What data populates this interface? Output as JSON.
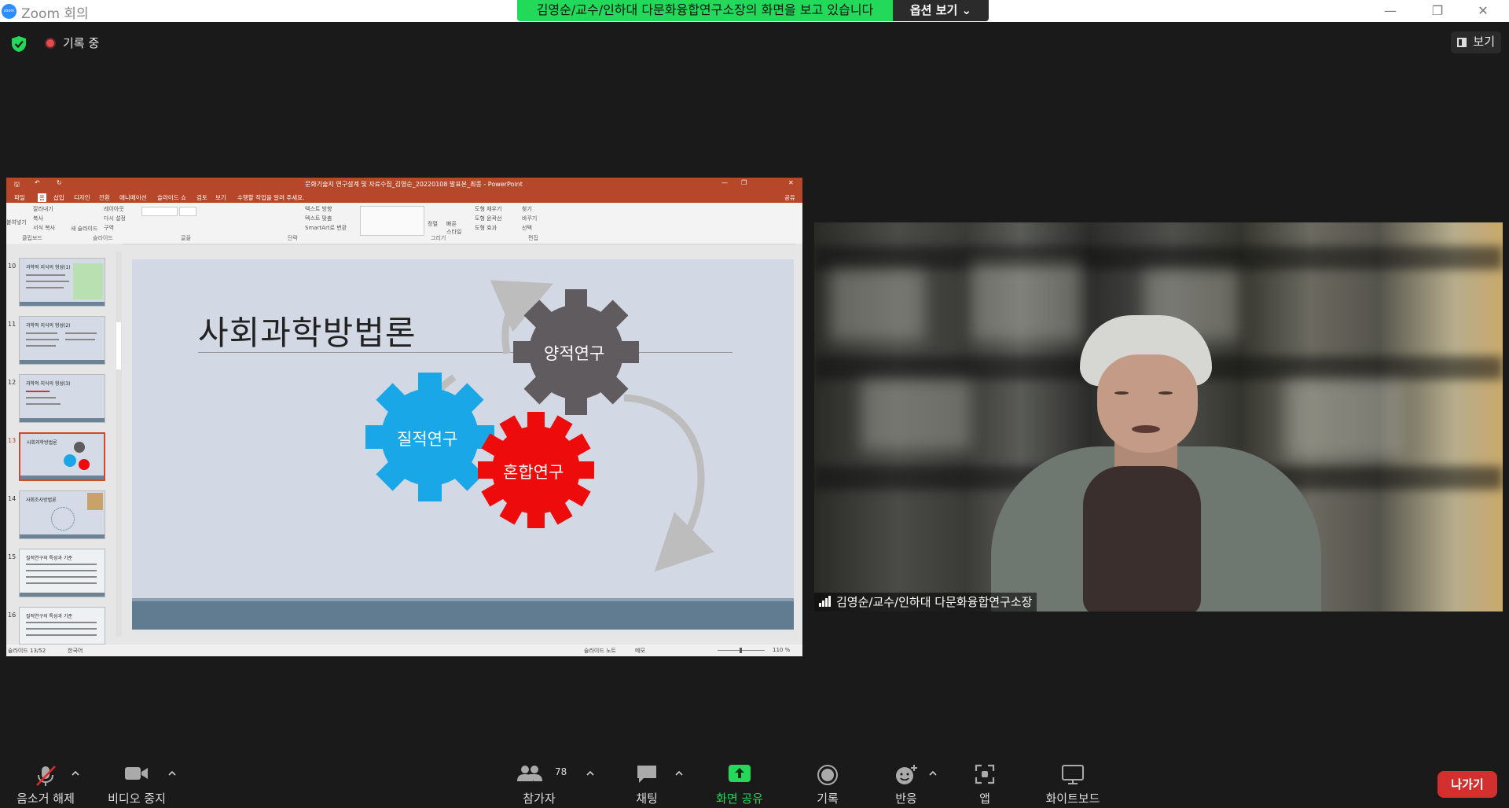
{
  "window": {
    "title": "Zoom 회의",
    "logo_text": "zoom"
  },
  "banner": {
    "share_text": "김영순/교수/인하대 다문화융합연구소장의 화면을 보고 있습니다",
    "options_label": "옵션 보기"
  },
  "top": {
    "recording_label": "기록 중",
    "view_label": "보기"
  },
  "ppt": {
    "title": "문화기술지 연구설계 및 자료수집_김영순_20220108 발표본_최종 - PowerPoint",
    "menu": [
      "파일",
      "홈",
      "삽입",
      "디자인",
      "전환",
      "애니메이션",
      "슬라이드 쇼",
      "검토",
      "보기"
    ],
    "tell_me": "수행할 작업을 알려 주세요.",
    "share_label": "공유",
    "ribbon_items": [
      "잘라내기",
      "복사",
      "서식 복사",
      "레이아웃",
      "다시 설정",
      "구역",
      "텍스트 방향",
      "텍스트 맞춤",
      "SmartArt로 변환",
      "도형 채우기",
      "도형 윤곽선",
      "도형 효과",
      "찾기",
      "바꾸기",
      "선택"
    ],
    "ribbon_paste": "붙여넣기",
    "ribbon_new_slide": "새 슬라이드",
    "ribbon_arrange": "정렬",
    "ribbon_quick": "빠른 스타일",
    "groups": [
      "클립보드",
      "슬라이드",
      "글꼴",
      "단락",
      "그리기",
      "편집"
    ],
    "thumbnails": [
      {
        "no": "10",
        "title": "과학적 지식의 형성(1)"
      },
      {
        "no": "11",
        "title": "과학적 지식의 형성(2)"
      },
      {
        "no": "12",
        "title": "과학적 지식의 형성(3)"
      },
      {
        "no": "13",
        "title": "사회과학방법론"
      },
      {
        "no": "14",
        "title": "사회조사방법론"
      },
      {
        "no": "15",
        "title": "질적연구의 특성과 기준"
      },
      {
        "no": "16",
        "title": "질적연구의 특성과 기준"
      }
    ],
    "slide": {
      "title": "사회과학방법론",
      "gear_quant": "양적연구",
      "gear_qual": "질적연구",
      "gear_mixed": "혼합연구",
      "colors": {
        "quant": "#5f5b5f",
        "qual": "#1aa7e8",
        "mixed": "#ee0b0b",
        "arrow": "#bdbdbd"
      }
    },
    "status": {
      "slide_no": "슬라이드 13/52",
      "lang": "한국어",
      "notes": "슬라이드 노트",
      "memo": "메모",
      "zoom": "110 %"
    }
  },
  "video": {
    "participant_name": "김영순/교수/인하대 다문화융합연구소장"
  },
  "toolbar": {
    "mute": "음소거 해제",
    "video": "비디오 중지",
    "participants": "참가자",
    "participant_count": "78",
    "chat": "채팅",
    "share": "화면 공유",
    "record": "기록",
    "reactions": "반응",
    "apps": "앱",
    "whiteboard": "화이트보드",
    "leave": "나가기"
  }
}
